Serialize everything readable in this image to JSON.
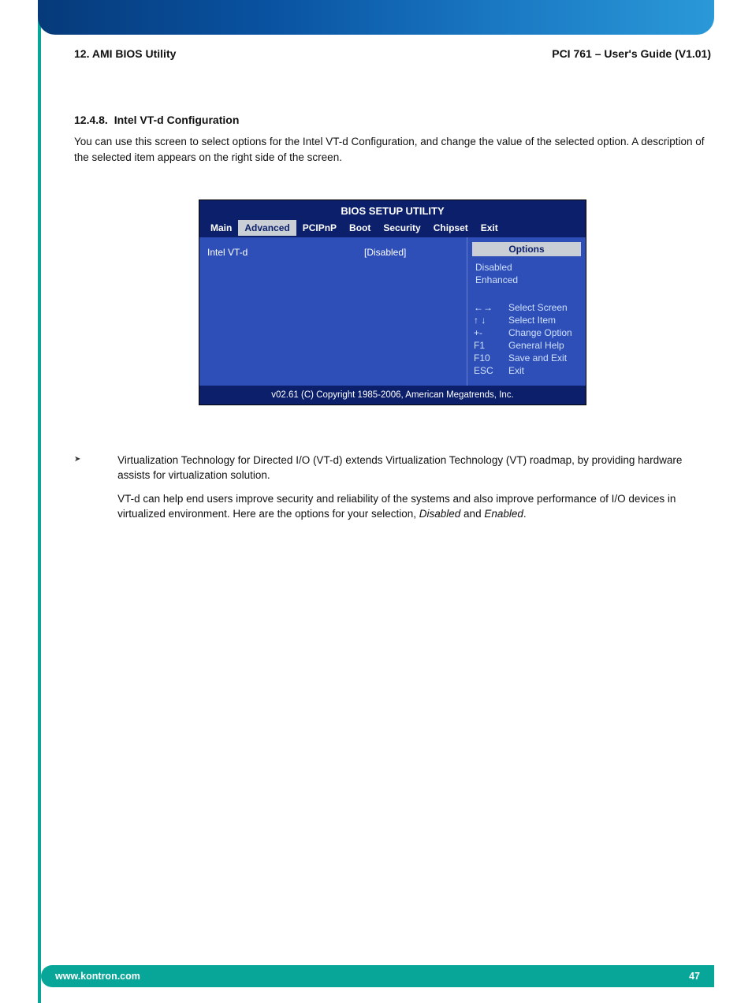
{
  "runhead": {
    "left": "12. AMI BIOS Utility",
    "right": "PCI 761 – User's Guide (V1.01)"
  },
  "section": {
    "number": "12.4.8.",
    "title": "Intel VT-d Configuration",
    "intro": "You can use this screen to select options for the Intel VT-d Configuration, and change the value of the selected option. A description of the selected item appears on the right side of the screen."
  },
  "bios": {
    "title": "BIOS SETUP UTILITY",
    "tabs": [
      "Main",
      "Advanced",
      "PCIPnP",
      "Boot",
      "Security",
      "Chipset",
      "Exit"
    ],
    "active_tab": "Advanced",
    "setting": {
      "label": "Intel VT-d",
      "value": "[Disabled]"
    },
    "options_header": "Options",
    "options": [
      "Disabled",
      "Enhanced"
    ],
    "keyhelp": [
      {
        "key": "←→",
        "desc": "Select Screen"
      },
      {
        "key": "↑ ↓",
        "desc": "Select Item"
      },
      {
        "key": "+-",
        "desc": "Change Option"
      },
      {
        "key": "F1",
        "desc": "General Help"
      },
      {
        "key": "F10",
        "desc": "Save and Exit"
      },
      {
        "key": "ESC",
        "desc": "Exit"
      }
    ],
    "footer": "v02.61 (C) Copyright 1985-2006, American Megatrends, Inc."
  },
  "note": {
    "p1": "Virtualization Technology for Directed I/O (VT-d) extends Virtualization Technology (VT) roadmap, by providing hardware assists for virtualization solution.",
    "p2a": "VT-d can help end users improve security and reliability of the systems and also improve performance of I/O devices in virtualized environment. Here are the options for your selection, ",
    "opt1": "Disabled",
    "sep": " and ",
    "opt2": "Enabled",
    "tail": "."
  },
  "footer": {
    "url": "www.kontron.com",
    "page": "47"
  }
}
